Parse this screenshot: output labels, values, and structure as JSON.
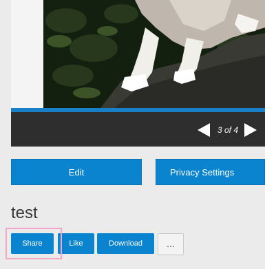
{
  "viewer": {
    "counter": "3 of 4",
    "prev_icon": "triangle-left-icon",
    "next_icon": "triangle-right-icon",
    "progress_color": "#1a7fc4"
  },
  "actions": {
    "edit_label": "Edit",
    "privacy_label": "Privacy Settings"
  },
  "item": {
    "title": "test"
  },
  "toolbar": {
    "share_label": "Share",
    "like_label": "Like",
    "download_label": "Download",
    "more_label": "..."
  },
  "colors": {
    "accent": "#0a84cf",
    "highlight": "#f2a7c6"
  }
}
